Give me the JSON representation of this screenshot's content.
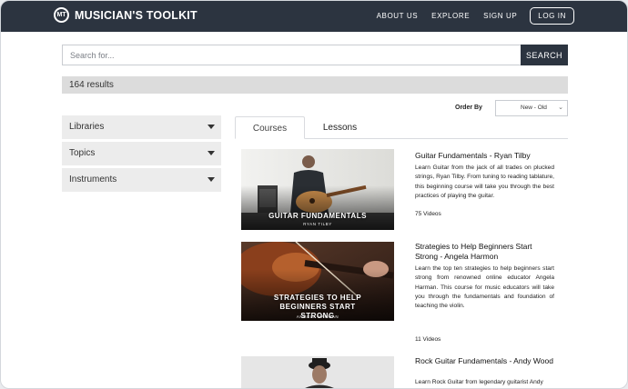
{
  "header": {
    "brand_mark": "MT",
    "brand_name": "MUSICIAN'S TOOLKIT",
    "nav": [
      "ABOUT US",
      "EXPLORE",
      "SIGN UP"
    ],
    "login": "LOG IN"
  },
  "search": {
    "placeholder": "Search for...",
    "button": "SEARCH"
  },
  "results": {
    "summary": "164 results"
  },
  "order": {
    "label": "Order By",
    "selected": "New - Old"
  },
  "filters": [
    "Libraries",
    "Topics",
    "Instruments"
  ],
  "tabs": [
    "Courses",
    "Lessons"
  ],
  "courses": [
    {
      "thumb_title": "GUITAR FUNDAMENTALS",
      "thumb_sub": "RYAN TILBY",
      "title": "Guitar Fundamentals - Ryan Tilby",
      "description": "Learn Guitar from the jack of all trades on plucked strings, Ryan Tilby. From tuning to reading tablature, this beginning course will take you through the best practices of playing the guitar.",
      "count": "75 Videos"
    },
    {
      "thumb_title": "STRATEGIES TO HELP BEGINNERS START STRONG",
      "thumb_sub": "ANGELA HARMAN",
      "title": "Strategies to Help Beginners Start Strong - Angela Harmon",
      "description": "Learn the top ten strategies to help beginners start strong from renowned online educator Angela Harman. This course for music educators will take you through the fundamentals and foundation of teaching the violin.",
      "count": "11 Videos"
    },
    {
      "title": "Rock Guitar Fundamentals - Andy Wood",
      "description": "Learn Rock Guitar from legendary guitarist Andy"
    }
  ],
  "colors": {
    "nav_bg": "#2c3440",
    "filter_bg": "#ececec",
    "results_bg": "#dcdcdc"
  }
}
